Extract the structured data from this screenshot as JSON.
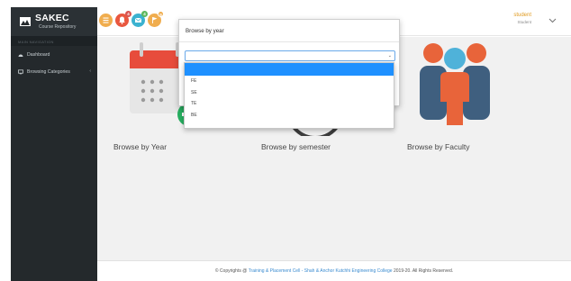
{
  "sidebar": {
    "brand_title": "SAKEC",
    "brand_subtitle": "Course Repository",
    "nav_header": "MAIN NAVIGATION",
    "items": [
      {
        "label": "Dashboard",
        "icon": "dashboard-icon"
      },
      {
        "label": "Browsing Categories",
        "icon": "monitor-icon",
        "caret": "‹"
      }
    ]
  },
  "topbar": {
    "notifications": [
      {
        "icon": "menu-icon",
        "color": "#f0ad4e"
      },
      {
        "icon": "bell-icon",
        "color": "#e9573f",
        "badge": "4"
      },
      {
        "icon": "mail-icon",
        "color": "#3bb2d0",
        "badge": "4"
      },
      {
        "icon": "flag-icon",
        "color": "#f0ad4e",
        "badge": "9"
      }
    ],
    "user_name": "student",
    "user_role": "Student"
  },
  "cards": [
    {
      "label": "Browse by Year",
      "icon": "calendar-icon"
    },
    {
      "label": "Browse by semester",
      "icon": "clock-icon"
    },
    {
      "label": "Browse by Faculty",
      "icon": "people-icon"
    }
  ],
  "modal": {
    "title": "Browse by year",
    "select_value": "",
    "options": [
      "",
      "FE",
      "SE",
      "TE",
      "BE"
    ]
  },
  "footer": {
    "prefix": "© Copyrights @",
    "link_text": "Training & Placement Cell - Shah & Anchor Kutchhi Engineering College",
    "suffix": "2019-20. All Rights Reserved."
  },
  "colors": {
    "accent_blue": "#1e90ff",
    "sidebar_bg": "#24292c",
    "user_name": "#e09b21"
  }
}
